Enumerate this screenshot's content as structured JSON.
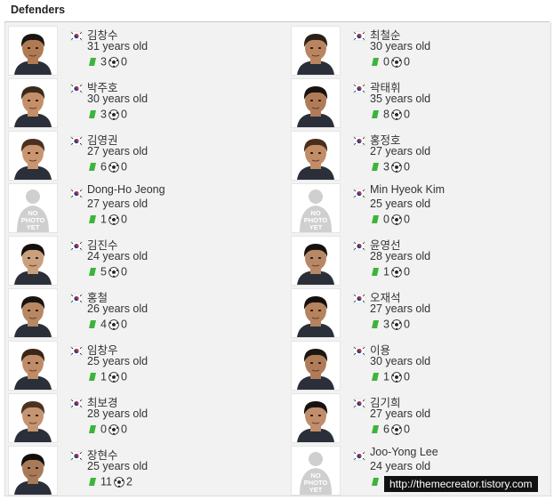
{
  "section": {
    "title": "Defenders"
  },
  "players": [
    {
      "name": "김창수",
      "age": "31 years old",
      "apps": "3",
      "goals": "0",
      "photo": "face",
      "skin": "#b07a52",
      "hair": "#1a1512"
    },
    {
      "name": "최철순",
      "age": "30 years old",
      "apps": "0",
      "goals": "0",
      "photo": "face",
      "skin": "#b98560",
      "hair": "#2a2018"
    },
    {
      "name": "박주호",
      "age": "30 years old",
      "apps": "3",
      "goals": "0",
      "photo": "face",
      "skin": "#c48f68",
      "hair": "#3a2a1c"
    },
    {
      "name": "곽태휘",
      "age": "35 years old",
      "apps": "8",
      "goals": "0",
      "photo": "face",
      "skin": "#b07c58",
      "hair": "#181210"
    },
    {
      "name": "김영권",
      "age": "27 years old",
      "apps": "6",
      "goals": "0",
      "photo": "face",
      "skin": "#c99470",
      "hair": "#4a3020"
    },
    {
      "name": "홍정호",
      "age": "27 years old",
      "apps": "3",
      "goals": "0",
      "photo": "face",
      "skin": "#c18c66",
      "hair": "#4a2e1c"
    },
    {
      "name": "Dong-Ho Jeong",
      "age": "27 years old",
      "apps": "1",
      "goals": "0",
      "photo": "none"
    },
    {
      "name": "Min Hyeok Kim",
      "age": "25 years old",
      "apps": "0",
      "goals": "0",
      "photo": "none"
    },
    {
      "name": "김진수",
      "age": "24 years old",
      "apps": "5",
      "goals": "0",
      "photo": "face",
      "skin": "#caa07c",
      "hair": "#14100e"
    },
    {
      "name": "윤영선",
      "age": "28 years old",
      "apps": "1",
      "goals": "0",
      "photo": "face",
      "skin": "#b88866",
      "hair": "#16110e"
    },
    {
      "name": "홍철",
      "age": "26 years old",
      "apps": "4",
      "goals": "0",
      "photo": "face",
      "skin": "#b88862",
      "hair": "#1a1410"
    },
    {
      "name": "오재석",
      "age": "27 years old",
      "apps": "3",
      "goals": "0",
      "photo": "face",
      "skin": "#b5835e",
      "hair": "#15100d"
    },
    {
      "name": "임창우",
      "age": "25 years old",
      "apps": "1",
      "goals": "0",
      "photo": "face",
      "skin": "#c08c68",
      "hair": "#3a2618"
    },
    {
      "name": "이용",
      "age": "30 years old",
      "apps": "1",
      "goals": "0",
      "photo": "face",
      "skin": "#b07c58",
      "hair": "#1c1612"
    },
    {
      "name": "최보경",
      "age": "28 years old",
      "apps": "0",
      "goals": "0",
      "photo": "face",
      "skin": "#c59470",
      "hair": "#4a3222"
    },
    {
      "name": "김기희",
      "age": "27 years old",
      "apps": "6",
      "goals": "0",
      "photo": "face",
      "skin": "#c08e6a",
      "hair": "#161210"
    },
    {
      "name": "장현수",
      "age": "25 years old",
      "apps": "11",
      "goals": "2",
      "photo": "face",
      "skin": "#a87a58",
      "hair": "#120e0c"
    },
    {
      "name": "Joo-Yong Lee",
      "age": "24 years old",
      "apps": "",
      "goals": "",
      "photo": "none"
    }
  ],
  "placeholder": {
    "line1": "NO",
    "line2": "PHOTO",
    "line3": "YET"
  },
  "watermark": "http://themecreator.tistory.com",
  "icons": {
    "flag": "korea-flag-icon",
    "shirt": "green-shirt-icon",
    "ball": "soccer-ball-icon"
  },
  "colors": {
    "shirt": "#3cb43c",
    "grid_bg": "#f2f2f2"
  }
}
